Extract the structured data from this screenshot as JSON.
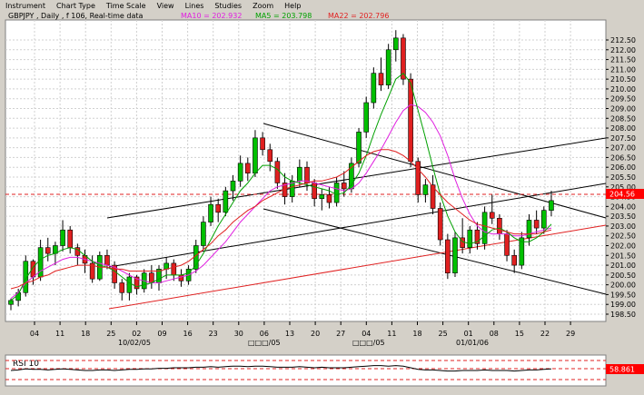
{
  "menu": [
    "Instrument",
    "Chart Type",
    "Time Scale",
    "View",
    "Lines",
    "Studies",
    "Zoom",
    "Help"
  ],
  "header": {
    "symbol_info": "GBPJPY , Daily , f 106, Real-time data",
    "ma10": "MA10 = 202.932",
    "ma5": "MA5 = 203.798",
    "ma22": "MA22 = 202.796"
  },
  "colors": {
    "ma10": "#e020e0",
    "ma5": "#00a000",
    "ma22": "#e02020",
    "up_candle": "#00c000",
    "down_candle": "#e02020",
    "price_marker_bg": "#ff0000"
  },
  "price_marker": {
    "label": "204.56"
  },
  "x_tick_labels": [
    "04",
    "11",
    "18",
    "25",
    "02",
    "09",
    "16",
    "23",
    "30",
    "06",
    "13",
    "20",
    "27",
    "04",
    "11",
    "18",
    "25",
    "01",
    "08",
    "15",
    "22",
    "29"
  ],
  "x_date_labels": [
    "10/02/05",
    "□□□/05",
    "□□□/05",
    "01/01/06"
  ],
  "rsi": {
    "label": "RSI 10",
    "value_label": "58.861"
  },
  "chart_data": {
    "type": "candlestick",
    "ylim": [
      198.5,
      213.5
    ],
    "y_tick_labels": [
      "212.50",
      "212.00",
      "211.50",
      "211.00",
      "210.50",
      "210.00",
      "209.50",
      "209.00",
      "208.50",
      "208.00",
      "207.50",
      "207.00",
      "206.50",
      "206.00",
      "205.50",
      "205.00",
      "204.50",
      "204.00",
      "203.50",
      "203.00",
      "202.50",
      "202.00",
      "201.50",
      "201.00",
      "200.50",
      "200.00",
      "199.50",
      "199.00",
      "198.50"
    ],
    "ohlc": [
      [
        199.0,
        199.3,
        198.7,
        199.2
      ],
      [
        199.2,
        199.8,
        198.9,
        199.6
      ],
      [
        199.6,
        201.5,
        199.4,
        201.2
      ],
      [
        201.2,
        201.3,
        200.0,
        200.4
      ],
      [
        200.4,
        202.3,
        200.2,
        201.9
      ],
      [
        201.9,
        202.4,
        201.2,
        201.6
      ],
      [
        201.6,
        202.2,
        201.0,
        202.0
      ],
      [
        202.0,
        203.3,
        201.7,
        202.8
      ],
      [
        202.8,
        203.0,
        201.6,
        201.9
      ],
      [
        201.9,
        202.1,
        201.0,
        201.5
      ],
      [
        201.5,
        201.8,
        200.6,
        201.1
      ],
      [
        201.1,
        201.5,
        200.1,
        200.3
      ],
      [
        200.3,
        201.7,
        200.2,
        201.5
      ],
      [
        201.5,
        201.8,
        200.8,
        201.0
      ],
      [
        201.0,
        201.2,
        199.8,
        200.1
      ],
      [
        200.1,
        200.3,
        199.2,
        199.6
      ],
      [
        199.6,
        200.6,
        199.2,
        200.4
      ],
      [
        200.4,
        200.5,
        199.5,
        199.8
      ],
      [
        199.8,
        200.8,
        199.6,
        200.6
      ],
      [
        200.6,
        201.0,
        199.8,
        200.1
      ],
      [
        200.1,
        201.0,
        199.7,
        200.8
      ],
      [
        200.8,
        201.4,
        200.3,
        201.1
      ],
      [
        201.1,
        201.3,
        200.2,
        200.5
      ],
      [
        200.5,
        200.8,
        199.9,
        200.2
      ],
      [
        200.2,
        201.0,
        200.0,
        200.8
      ],
      [
        200.8,
        202.3,
        200.6,
        202.0
      ],
      [
        202.0,
        203.5,
        201.8,
        203.2
      ],
      [
        203.2,
        204.5,
        203.0,
        204.1
      ],
      [
        204.1,
        204.4,
        203.2,
        203.7
      ],
      [
        203.7,
        205.0,
        203.5,
        204.8
      ],
      [
        204.8,
        205.6,
        204.3,
        205.3
      ],
      [
        205.3,
        206.6,
        205.0,
        206.2
      ],
      [
        206.2,
        206.5,
        205.3,
        205.7
      ],
      [
        205.7,
        207.9,
        205.5,
        207.5
      ],
      [
        207.5,
        207.8,
        206.6,
        206.9
      ],
      [
        206.9,
        207.2,
        205.8,
        206.3
      ],
      [
        206.3,
        206.5,
        204.9,
        205.2
      ],
      [
        205.2,
        205.7,
        204.1,
        204.5
      ],
      [
        204.5,
        205.6,
        204.2,
        205.3
      ],
      [
        205.3,
        206.4,
        205.0,
        206.0
      ],
      [
        206.0,
        206.3,
        204.8,
        205.2
      ],
      [
        205.2,
        205.4,
        204.0,
        204.4
      ],
      [
        204.4,
        204.9,
        203.8,
        204.6
      ],
      [
        204.6,
        205.0,
        203.9,
        204.2
      ],
      [
        204.2,
        205.5,
        204.0,
        205.2
      ],
      [
        205.2,
        205.8,
        204.5,
        204.9
      ],
      [
        204.9,
        206.5,
        204.7,
        206.2
      ],
      [
        206.2,
        208.0,
        206.0,
        207.8
      ],
      [
        207.8,
        209.6,
        207.5,
        209.3
      ],
      [
        209.3,
        211.1,
        209.0,
        210.8
      ],
      [
        210.8,
        211.6,
        209.9,
        210.2
      ],
      [
        210.2,
        212.3,
        210.0,
        212.0
      ],
      [
        212.0,
        213.0,
        211.4,
        212.6
      ],
      [
        212.6,
        212.8,
        210.2,
        210.5
      ],
      [
        210.5,
        210.8,
        206.0,
        206.3
      ],
      [
        206.3,
        206.5,
        204.2,
        204.6
      ],
      [
        204.6,
        205.4,
        204.2,
        205.1
      ],
      [
        205.1,
        205.6,
        203.6,
        203.9
      ],
      [
        203.9,
        204.2,
        202.0,
        202.3
      ],
      [
        202.3,
        202.6,
        200.3,
        200.6
      ],
      [
        200.6,
        202.7,
        200.4,
        202.4
      ],
      [
        202.4,
        203.4,
        201.6,
        201.9
      ],
      [
        201.9,
        203.0,
        201.6,
        202.8
      ],
      [
        202.8,
        203.2,
        201.8,
        202.1
      ],
      [
        202.1,
        204.0,
        201.8,
        203.7
      ],
      [
        203.7,
        204.6,
        203.1,
        203.4
      ],
      [
        203.4,
        203.6,
        202.3,
        202.6
      ],
      [
        202.6,
        202.8,
        201.2,
        201.5
      ],
      [
        201.5,
        201.8,
        200.6,
        201.0
      ],
      [
        201.0,
        202.7,
        200.8,
        202.4
      ],
      [
        202.4,
        203.6,
        202.0,
        203.3
      ],
      [
        203.3,
        203.8,
        202.6,
        202.9
      ],
      [
        202.9,
        204.0,
        202.6,
        203.8
      ],
      [
        203.8,
        204.8,
        203.5,
        204.3
      ]
    ],
    "series": [
      {
        "name": "MA10",
        "values": [
          199.3,
          199.6,
          200.1,
          200.4,
          200.7,
          200.9,
          201.1,
          201.3,
          201.4,
          201.4,
          201.3,
          201.2,
          201.1,
          201.0,
          200.9,
          200.7,
          200.5,
          200.3,
          200.2,
          200.1,
          200.1,
          200.2,
          200.3,
          200.4,
          200.5,
          200.7,
          201.0,
          201.4,
          201.8,
          202.2,
          202.7,
          203.2,
          203.6,
          204.0,
          204.4,
          204.8,
          205.0,
          205.1,
          205.2,
          205.3,
          205.3,
          205.2,
          205.1,
          205.0,
          204.9,
          204.8,
          204.9,
          205.2,
          205.7,
          206.3,
          206.9,
          207.6,
          208.3,
          208.9,
          209.2,
          209.1,
          208.8,
          208.3,
          207.6,
          206.6,
          205.4,
          204.4,
          203.6,
          203.0,
          202.7,
          202.6,
          202.6,
          202.6,
          202.5,
          202.5,
          202.6,
          202.7,
          202.8,
          202.9
        ]
      },
      {
        "name": "MA5",
        "values": [
          199.2,
          199.5,
          200.3,
          200.9,
          201.3,
          201.5,
          201.6,
          201.8,
          201.9,
          201.8,
          201.5,
          201.2,
          201.0,
          200.9,
          200.7,
          200.4,
          200.1,
          199.9,
          200.0,
          200.1,
          200.3,
          200.5,
          200.5,
          200.5,
          200.6,
          201.0,
          201.6,
          202.3,
          203.0,
          203.6,
          204.2,
          204.8,
          205.2,
          205.7,
          206.1,
          206.1,
          205.9,
          205.5,
          205.3,
          205.2,
          205.1,
          205.0,
          204.9,
          204.8,
          204.6,
          204.7,
          205.1,
          205.7,
          206.6,
          207.7,
          208.7,
          209.6,
          210.5,
          210.8,
          210.3,
          208.9,
          207.5,
          206.0,
          204.6,
          203.5,
          202.7,
          202.2,
          202.1,
          202.2,
          202.5,
          202.8,
          202.9,
          202.7,
          202.4,
          202.2,
          202.2,
          202.4,
          202.7,
          203.1
        ]
      },
      {
        "name": "MA22",
        "values": [
          199.8,
          199.9,
          200.1,
          200.2,
          200.4,
          200.5,
          200.7,
          200.8,
          200.9,
          201.0,
          201.0,
          201.0,
          200.9,
          200.9,
          200.8,
          200.8,
          200.7,
          200.7,
          200.7,
          200.7,
          200.7,
          200.8,
          200.9,
          201.0,
          201.2,
          201.5,
          201.8,
          202.1,
          202.5,
          202.8,
          203.2,
          203.5,
          203.8,
          204.0,
          204.3,
          204.5,
          204.7,
          204.9,
          205.0,
          205.1,
          205.2,
          205.3,
          205.3,
          205.4,
          205.5,
          205.7,
          206.0,
          206.3,
          206.6,
          206.8,
          206.9,
          206.9,
          206.8,
          206.6,
          206.3,
          205.9,
          205.5,
          205.0,
          204.6,
          204.2,
          203.9,
          203.6,
          203.3,
          203.1,
          203.0,
          202.9,
          202.8,
          202.7,
          202.6,
          202.6,
          202.6,
          202.6,
          202.7,
          202.8
        ]
      }
    ],
    "rsi_values": [
      55,
      56,
      58,
      57,
      57,
      56,
      57,
      58,
      57,
      56,
      55,
      55,
      56,
      56,
      55,
      56,
      57,
      57,
      58,
      58,
      59,
      59,
      60,
      60,
      60,
      61,
      61,
      62,
      61,
      62,
      63,
      63,
      62,
      63,
      63,
      62,
      61,
      61,
      61,
      62,
      61,
      60,
      61,
      60,
      60,
      60,
      61,
      62,
      63,
      64,
      64,
      63,
      64,
      63,
      60,
      57,
      56,
      56,
      55,
      54,
      54,
      55,
      55,
      55,
      56,
      55,
      55,
      55,
      54,
      55,
      56,
      56,
      57,
      58
    ]
  }
}
